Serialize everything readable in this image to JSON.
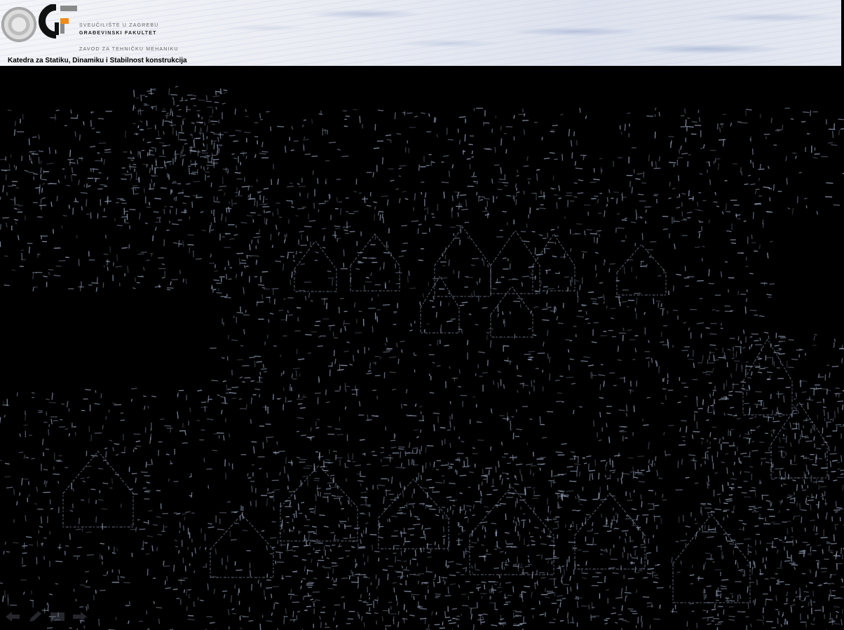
{
  "header": {
    "university": "SVEUČILIŠTE U ZAGREBU",
    "faculty": "GRAĐEVINSKI FAKULTET",
    "institute": "ZAVOD ZA TEHNIČKU MEHANIKU",
    "department": "Katedra za Statiku, Dinamiku i Stabilnost konstrukcija"
  },
  "colors": {
    "background": "#000000",
    "logo_orange": "#f08a1c",
    "logo_gray": "#8a8a8a",
    "edge_lines": "#8e9cb4"
  },
  "nav": {
    "icons": [
      "arrow-left-icon",
      "pen-icon",
      "menu-icon",
      "arrow-right-icon"
    ]
  }
}
